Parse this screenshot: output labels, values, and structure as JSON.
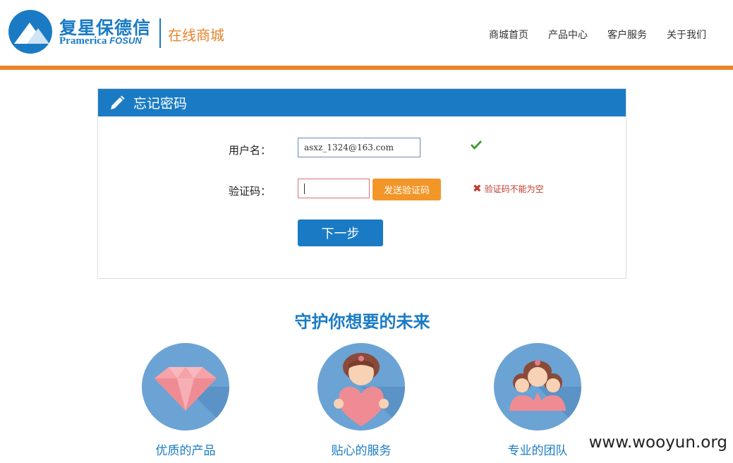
{
  "brand": {
    "name_cn": "复星保德信",
    "name_en": "Pramerica",
    "name_en_suffix": "FOSUN",
    "subtitle": "在线商城"
  },
  "nav": [
    {
      "label": "商城首页"
    },
    {
      "label": "产品中心"
    },
    {
      "label": "客户服务"
    },
    {
      "label": "关于我们"
    }
  ],
  "panel": {
    "title": "忘记密码",
    "username_label": "用户名：",
    "username_value": "asxz_1324@163.com",
    "code_label": "验证码：",
    "code_value": "",
    "send_button": "发送验证码",
    "error_text": "验证码不能为空",
    "next_button": "下一步"
  },
  "slogan": "守护你想要的未来",
  "features": [
    {
      "label": "优质的产品",
      "icon": "diamond-icon"
    },
    {
      "label": "贴心的服务",
      "icon": "heart-person-icon"
    },
    {
      "label": "专业的团队",
      "icon": "team-icon"
    }
  ],
  "watermark": "www.wooyun.org",
  "colors": {
    "primary": "#1a7bc4",
    "accent": "#e8842a",
    "button_orange": "#f39628",
    "error": "#c0392b",
    "success": "#3a9a2f"
  }
}
